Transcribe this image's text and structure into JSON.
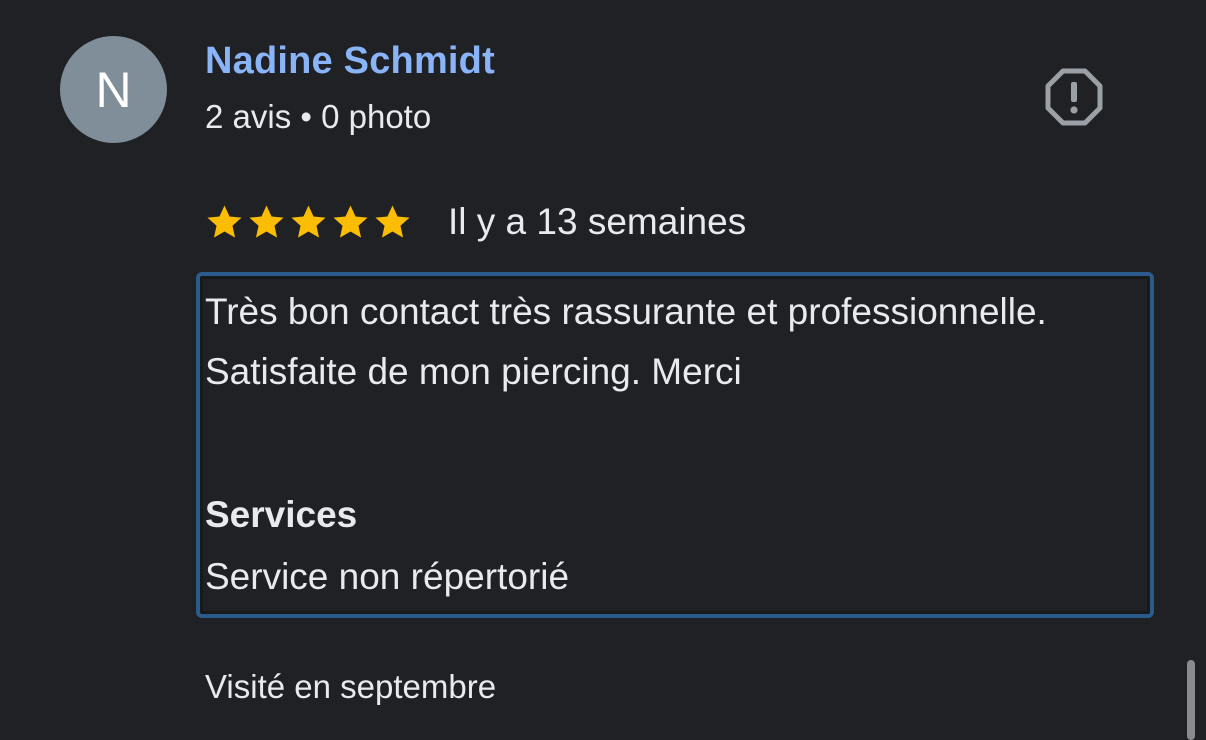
{
  "review": {
    "author": {
      "initial": "N",
      "name": "Nadine Schmidt",
      "meta": "2 avis • 0 photo",
      "avatar_color": "#7f8e98"
    },
    "report_icon": "report-flag-icon",
    "rating": {
      "stars": 5,
      "max": 5,
      "star_color": "#fbbc04",
      "date": "Il y a 13 semaines"
    },
    "text": "Très bon contact très rassurante et professionnelle. Satisfaite de mon piercing. Merci",
    "services": {
      "title": "Services",
      "value": "Service non répertorié"
    },
    "visit": "Visité en septembre"
  },
  "colors": {
    "background": "#202124",
    "link": "#8ab4f8",
    "highlight_border": "#2b5b8c"
  }
}
